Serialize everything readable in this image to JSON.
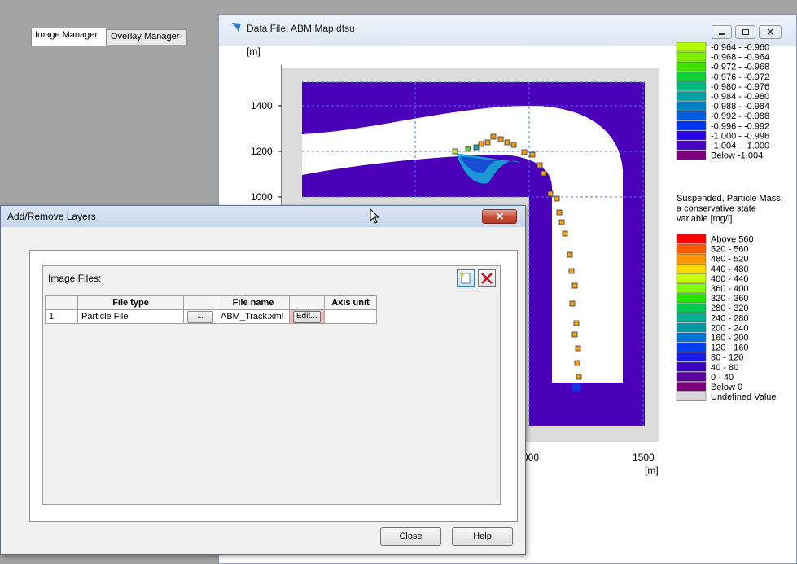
{
  "datawin": {
    "title": "Data File: ABM Map.dfsu",
    "yunit": "[m]",
    "xunit": "[m]",
    "yticks": [
      "1400",
      "1200",
      "1000"
    ],
    "xticks": [
      "000",
      "1500"
    ]
  },
  "legend_top": {
    "colors": [
      "#b5ff00",
      "#7cf200",
      "#3fe000",
      "#10cf34",
      "#00b97c",
      "#00a3a3",
      "#0083c6",
      "#005ee0",
      "#0035ee",
      "#2a00e6",
      "#4a00c2",
      "#7b0080"
    ],
    "labels": [
      "-0.964 - -0.960",
      "-0.968 - -0.964",
      "-0.972 - -0.968",
      "-0.976 - -0.972",
      "-0.980 - -0.976",
      "-0.984 - -0.980",
      "-0.988 - -0.984",
      "-0.992 - -0.988",
      "-0.996 - -0.992",
      "-1.000 - -0.996",
      "-1.004 - -1.000",
      "Below   -1.004"
    ]
  },
  "legend_bottom": {
    "title_lines": [
      "Suspended, Particle Mass,",
      "a conservative state",
      "variable [mg/l]"
    ],
    "colors": [
      "#ff0000",
      "#ff5a00",
      "#ff9800",
      "#ffd700",
      "#c8ff00",
      "#80ff00",
      "#25e600",
      "#00c850",
      "#00b090",
      "#009aa6",
      "#0074d0",
      "#0040f0",
      "#1a1ae6",
      "#3a00c8",
      "#5a00a0",
      "#7d007d",
      "#d8d8d8"
    ],
    "labels": [
      "Above 560",
      "520 - 560",
      "480 - 520",
      "440 - 480",
      "400 - 440",
      "360 - 400",
      "320 - 360",
      "280 - 320",
      "240 - 280",
      "200 - 240",
      "160 - 200",
      "120 - 160",
      "80 - 120",
      "40 -  80",
      "0 -  40",
      "Below    0",
      "Undefined Value"
    ]
  },
  "dialog": {
    "title": "Add/Remove Layers",
    "tabs": [
      "Image Manager",
      "Overlay Manager"
    ],
    "image_files_label": "Image Files:",
    "columns": [
      "",
      "File type",
      "",
      "File name",
      "",
      "Axis unit"
    ],
    "rows": [
      {
        "num": "1",
        "file_type": "Particle File",
        "browse": "...",
        "file_name": "ABM_Track.xml",
        "edit": "Edit...",
        "axis_unit": ""
      }
    ],
    "close_label": "Close",
    "help_label": "Help"
  }
}
